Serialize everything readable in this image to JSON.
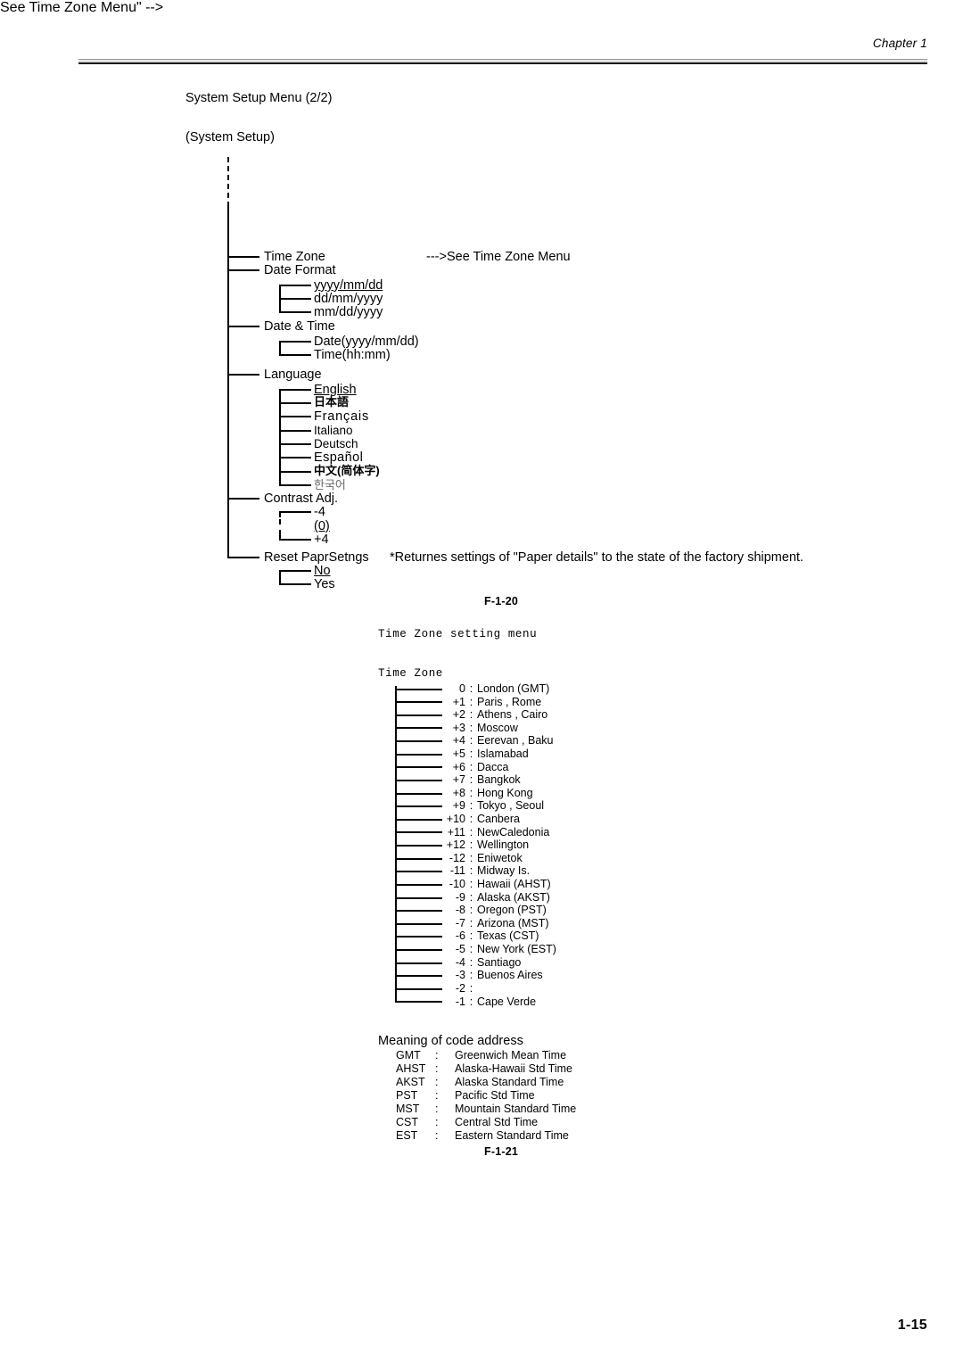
{
  "header": {
    "chapter": "Chapter 1"
  },
  "footer": {
    "page_number": "1-15"
  },
  "diagram1": {
    "title": "System Setup Menu (2/2)",
    "root": "(System Setup)",
    "caption": "F-1-20",
    "note": "*Returnes settings of \"Paper details\" to the state of the factory shipment.",
    "timezone_ref": "--->See Time Zone Menu",
    "nodes": [
      {
        "label": "Time Zone"
      },
      {
        "label": "Date Format"
      },
      {
        "label": "Date & Time"
      },
      {
        "label": "Language"
      },
      {
        "label": "Contrast Adj."
      },
      {
        "label": "Reset PaprSetngs"
      }
    ],
    "date_format_options": [
      "yyyy/mm/dd",
      "dd/mm/yyyy",
      "mm/dd/yyyy"
    ],
    "date_time_options": [
      "Date(yyyy/mm/dd)",
      "Time(hh:mm)"
    ],
    "language_options": [
      "English",
      "日本語",
      "Français",
      "Italiano",
      "Deutsch",
      "Español",
      "中文(简体字)",
      "한국어"
    ],
    "contrast_options": [
      "-4",
      "(0)",
      "+4"
    ],
    "reset_options": [
      "No",
      "Yes"
    ]
  },
  "diagram2": {
    "heading": "Time Zone setting menu",
    "root": "Time Zone",
    "caption": "F-1-21",
    "zones": [
      {
        "offset": "0",
        "colon": ":",
        "cities": "London (GMT)"
      },
      {
        "offset": "+1",
        "colon": ":",
        "cities": "Paris , Rome"
      },
      {
        "offset": "+2",
        "colon": ":",
        "cities": "Athens , Cairo"
      },
      {
        "offset": "+3",
        "colon": ":",
        "cities": "Moscow"
      },
      {
        "offset": "+4",
        "colon": ":",
        "cities": "Eerevan , Baku"
      },
      {
        "offset": "+5",
        "colon": ":",
        "cities": "Islamabad"
      },
      {
        "offset": "+6",
        "colon": ":",
        "cities": "Dacca"
      },
      {
        "offset": "+7",
        "colon": ":",
        "cities": "Bangkok"
      },
      {
        "offset": "+8",
        "colon": ":",
        "cities": "Hong Kong"
      },
      {
        "offset": "+9",
        "colon": ":",
        "cities": "Tokyo , Seoul"
      },
      {
        "offset": "+10",
        "colon": ":",
        "cities": "Canbera"
      },
      {
        "offset": "+11",
        "colon": ":",
        "cities": "NewCaledonia"
      },
      {
        "offset": "+12",
        "colon": ":",
        "cities": "Wellington"
      },
      {
        "offset": "-12",
        "colon": ":",
        "cities": "Eniwetok"
      },
      {
        "offset": "-11",
        "colon": ":",
        "cities": "Midway Is."
      },
      {
        "offset": "-10",
        "colon": ":",
        "cities": "Hawaii (AHST)"
      },
      {
        "offset": "-9",
        "colon": ":",
        "cities": "Alaska (AKST)"
      },
      {
        "offset": "-8",
        "colon": ":",
        "cities": "Oregon (PST)"
      },
      {
        "offset": "-7",
        "colon": ":",
        "cities": "Arizona (MST)"
      },
      {
        "offset": "-6",
        "colon": ":",
        "cities": "Texas (CST)"
      },
      {
        "offset": "-5",
        "colon": ":",
        "cities": "New York (EST)"
      },
      {
        "offset": "-4",
        "colon": ":",
        "cities": "Santiago"
      },
      {
        "offset": "-3",
        "colon": ":",
        "cities": "Buenos Aires"
      },
      {
        "offset": "-2",
        "colon": ":",
        "cities": ""
      },
      {
        "offset": "-1",
        "colon": ":",
        "cities": "Cape Verde"
      }
    ],
    "code_heading": "Meaning of code address",
    "codes": [
      {
        "code": "GMT",
        "colon": ":",
        "meaning": "Greenwich Mean Time"
      },
      {
        "code": "AHST",
        "colon": ":",
        "meaning": "Alaska-Hawaii Std Time"
      },
      {
        "code": "AKST",
        "colon": ":",
        "meaning": "Alaska Standard Time"
      },
      {
        "code": "PST",
        "colon": ":",
        "meaning": "Pacific Std Time"
      },
      {
        "code": "MST",
        "colon": ":",
        "meaning": "Mountain Standard Time"
      },
      {
        "code": "CST",
        "colon": ":",
        "meaning": "Central Std Time"
      },
      {
        "code": "EST",
        "colon": ":",
        "meaning": "Eastern Standard Time"
      }
    ]
  }
}
